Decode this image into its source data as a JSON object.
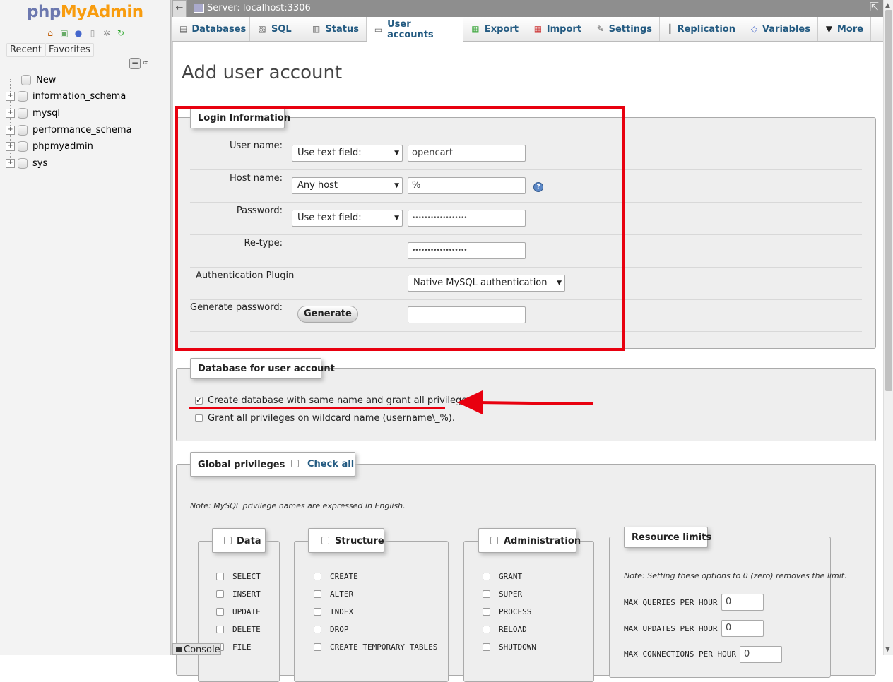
{
  "sidebar": {
    "logo_php": "php",
    "logo_myadmin": "MyAdmin",
    "recent_label": "Recent",
    "favorites_label": "Favorites",
    "new_label": "New",
    "databases": [
      "information_schema",
      "mysql",
      "performance_schema",
      "phpmyadmin",
      "sys"
    ]
  },
  "serverbar": {
    "back": "←",
    "title": "Server: localhost:3306",
    "close": "⇱"
  },
  "tabs": [
    {
      "label": "Databases",
      "icon": "database-icon"
    },
    {
      "label": "SQL",
      "icon": "sql-icon"
    },
    {
      "label": "Status",
      "icon": "status-icon"
    },
    {
      "label": "User accounts",
      "icon": "users-icon"
    },
    {
      "label": "Export",
      "icon": "export-icon"
    },
    {
      "label": "Import",
      "icon": "import-icon"
    },
    {
      "label": "Settings",
      "icon": "wrench-icon"
    },
    {
      "label": "Replication",
      "icon": "replication-icon"
    },
    {
      "label": "Variables",
      "icon": "variables-icon"
    },
    {
      "label": "More",
      "icon": "chevron-down-icon"
    }
  ],
  "page_title": "Add user account",
  "login": {
    "legend": "Login Information",
    "user_name_label": "User name:",
    "user_name_mode": "Use text field:",
    "user_name_value": "opencart",
    "host_name_label": "Host name:",
    "host_mode": "Any host",
    "host_value": "%",
    "password_label": "Password:",
    "password_mode": "Use text field:",
    "password_value": "••••••••••••••••••",
    "retype_label": "Re-type:",
    "retype_value": "••••••••••••••••••",
    "auth_label": "Authentication Plugin",
    "auth_value": "Native MySQL authentication",
    "generate_label": "Generate password:",
    "generate_button": "Generate",
    "generate_value": ""
  },
  "dbsection": {
    "legend": "Database for user account",
    "create_db_label": "Create database with same name and grant all privileges.",
    "create_db_checked": true,
    "wildcard_label": "Grant all privileges on wildcard name (username\\_%)."
  },
  "global": {
    "legend": "Global privileges",
    "check_all": "Check all",
    "note": "Note: MySQL privilege names are expressed in English.",
    "data_legend": "Data",
    "data_privs": [
      "SELECT",
      "INSERT",
      "UPDATE",
      "DELETE",
      "FILE"
    ],
    "structure_legend": "Structure",
    "structure_privs": [
      "CREATE",
      "ALTER",
      "INDEX",
      "DROP",
      "CREATE TEMPORARY TABLES"
    ],
    "admin_legend": "Administration",
    "admin_privs": [
      "GRANT",
      "SUPER",
      "PROCESS",
      "RELOAD",
      "SHUTDOWN"
    ],
    "resource_legend": "Resource limits",
    "resource_note": "Note: Setting these options to 0 (zero) removes the limit.",
    "max_queries_label": "MAX QUERIES PER HOUR",
    "max_queries_value": "0",
    "max_updates_label": "MAX UPDATES PER HOUR",
    "max_updates_value": "0",
    "max_connections_label": "MAX CONNECTIONS PER HOUR",
    "max_connections_value": "0"
  },
  "console_label": "Console",
  "colors": {
    "annotation_red": "#e8000f",
    "link_blue": "#235a81",
    "logo_php": "#6c78af",
    "logo_myadmin": "#f89c0e"
  }
}
